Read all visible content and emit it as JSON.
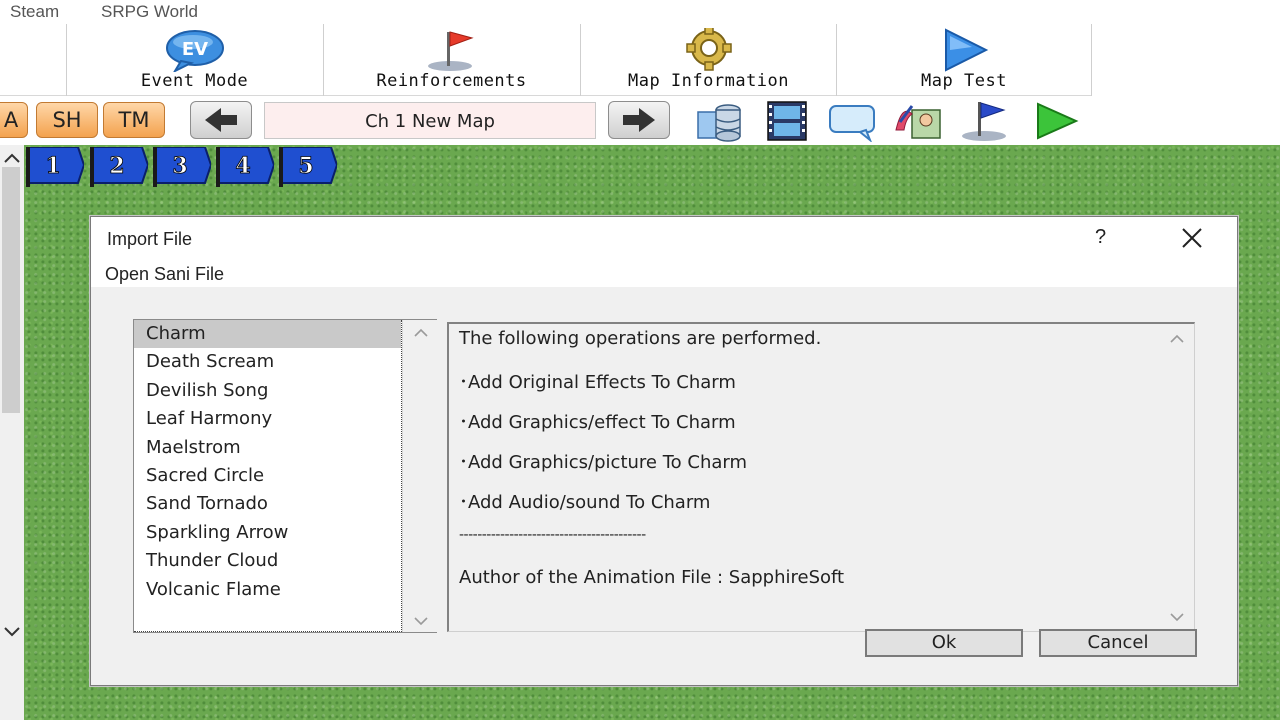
{
  "menubar": {
    "items": [
      "Steam",
      "SRPG World"
    ]
  },
  "toolbar": {
    "buttons": [
      {
        "label": "Event Mode",
        "icon": "ev-bubble-icon",
        "badge": "EV"
      },
      {
        "label": "Reinforcements",
        "icon": "red-flag-icon"
      },
      {
        "label": "Map Information",
        "icon": "gear-icon"
      },
      {
        "label": "Map Test",
        "icon": "play-triangle-icon"
      }
    ]
  },
  "subtoolbar": {
    "mode_buttons": [
      "A",
      "SH",
      "TM"
    ],
    "map_name": "Ch 1 New Map",
    "icons": [
      "database-icon",
      "film-strip-icon",
      "speech-bubble-icon",
      "character-edit-icon",
      "blue-flag-icon",
      "green-play-icon"
    ]
  },
  "flag_tabs": [
    "1",
    "2",
    "3",
    "4",
    "5"
  ],
  "dialog": {
    "title": "Import File",
    "subtitle": "Open Sani File",
    "help": "?",
    "list_items": [
      "Charm",
      "Death Scream",
      "Devilish Song",
      "Leaf Harmony",
      "Maelstrom",
      "Sacred Circle",
      "Sand Tornado",
      "Sparkling Arrow",
      "Thunder Cloud",
      "Volcanic Flame"
    ],
    "selected_item": "Charm",
    "description_lines": [
      "The following operations are performed.",
      "･Add Original Effects To Charm",
      "･Add Graphics/effect To Charm",
      "･Add Graphics/picture To Charm",
      "･Add Audio/sound To Charm",
      "-----------------------------------------",
      "Author of the Animation File : SapphireSoft"
    ],
    "ok_label": "Ok",
    "cancel_label": "Cancel"
  }
}
